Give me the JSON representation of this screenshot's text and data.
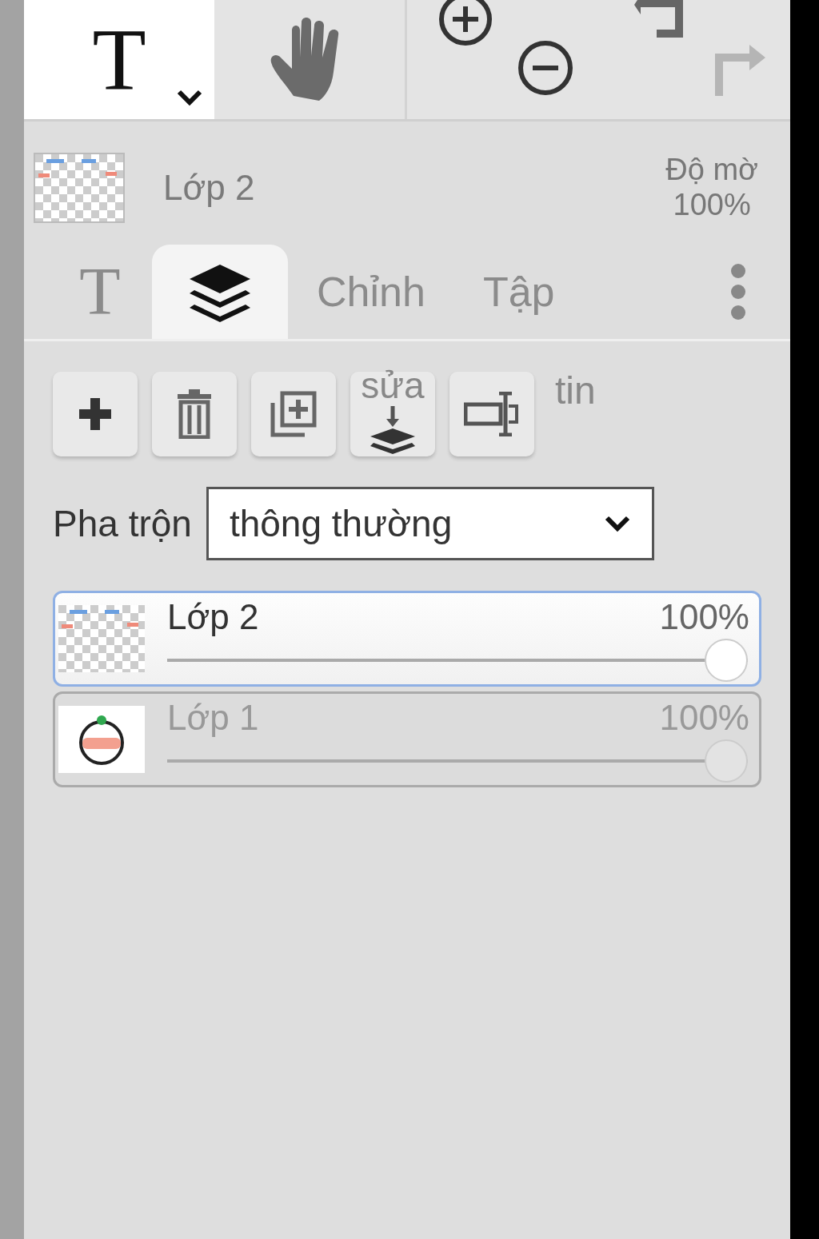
{
  "toolbar": {
    "tools": [
      {
        "kind": "text",
        "label": "T",
        "selected": true
      },
      {
        "kind": "hand",
        "selected": false
      }
    ],
    "zoom": [
      {
        "kind": "zoom-in"
      },
      {
        "kind": "zoom-out"
      }
    ],
    "history": [
      {
        "kind": "undo",
        "disabled": false
      },
      {
        "kind": "redo",
        "disabled": true
      }
    ]
  },
  "current_layer": {
    "kind": "transparent",
    "name": "Lớp 2",
    "opacity_label": "Độ mờ",
    "opacity": "100%"
  },
  "tabs": [
    {
      "kind": "glyph",
      "label": "T",
      "selected": false
    },
    {
      "kind": "layers",
      "selected": true
    },
    {
      "kind": "text",
      "label": "Chỉnh",
      "selected": false
    },
    {
      "kind": "text",
      "label": "Tập",
      "selected": false
    },
    {
      "kind": "more",
      "selected": false
    }
  ],
  "layer_actions": [
    {
      "kind": "add"
    },
    {
      "kind": "delete"
    },
    {
      "kind": "duplicate"
    },
    {
      "kind": "merge",
      "caption": "sửa"
    },
    {
      "kind": "rename"
    }
  ],
  "layer_actions_trailing": "tin",
  "blend": {
    "label": "Pha trộn",
    "value": "thông thường"
  },
  "layers": [
    {
      "kind": "transparent",
      "name": "Lớp 2",
      "opacity": "100%",
      "level": 1,
      "selected": true
    },
    {
      "kind": "figure",
      "name": "Lớp 1",
      "opacity": "100%",
      "level": 1,
      "selected": false
    }
  ]
}
